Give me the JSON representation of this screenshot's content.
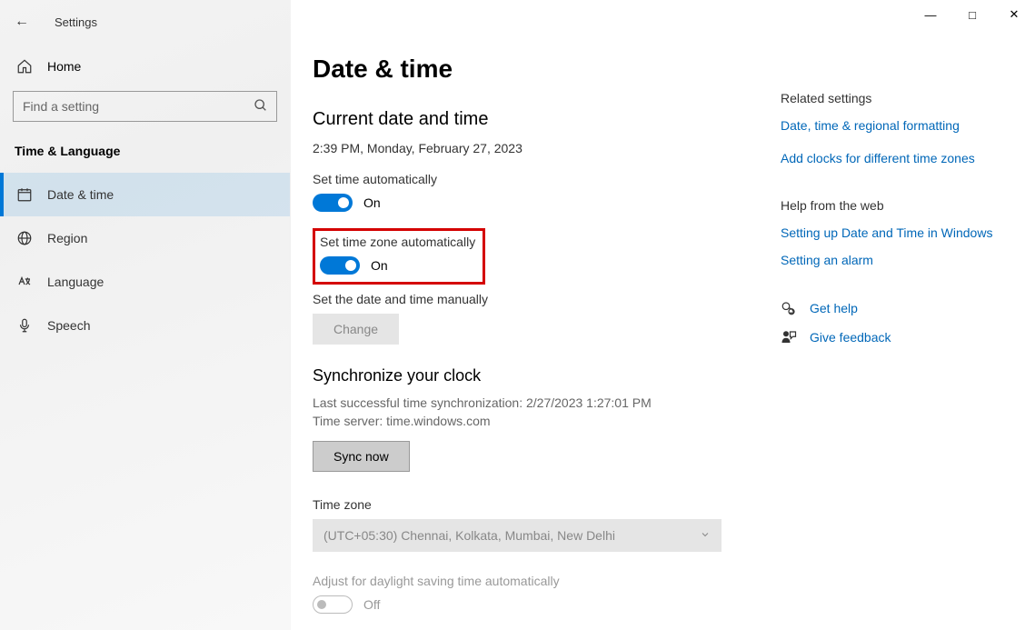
{
  "app": {
    "title": "Settings"
  },
  "sidebar": {
    "home": "Home",
    "search_placeholder": "Find a setting",
    "category": "Time & Language",
    "items": [
      {
        "label": "Date & time"
      },
      {
        "label": "Region"
      },
      {
        "label": "Language"
      },
      {
        "label": "Speech"
      }
    ]
  },
  "page": {
    "title": "Date & time",
    "current_heading": "Current date and time",
    "current_value": "2:39 PM, Monday, February 27, 2023",
    "set_time_auto_label": "Set time automatically",
    "set_time_auto_state": "On",
    "set_tz_auto_label": "Set time zone automatically",
    "set_tz_auto_state": "On",
    "manual_label": "Set the date and time manually",
    "change_btn": "Change",
    "sync_heading": "Synchronize your clock",
    "sync_last": "Last successful time synchronization: 2/27/2023 1:27:01 PM",
    "sync_server": "Time server: time.windows.com",
    "sync_btn": "Sync now",
    "tz_heading": "Time zone",
    "tz_value": "(UTC+05:30) Chennai, Kolkata, Mumbai, New Delhi",
    "dst_label": "Adjust for daylight saving time automatically",
    "dst_state": "Off"
  },
  "right": {
    "related_heading": "Related settings",
    "related_links": [
      "Date, time & regional formatting",
      "Add clocks for different time zones"
    ],
    "help_heading": "Help from the web",
    "help_links": [
      "Setting up Date and Time in Windows",
      "Setting an alarm"
    ],
    "get_help": "Get help",
    "feedback": "Give feedback"
  }
}
